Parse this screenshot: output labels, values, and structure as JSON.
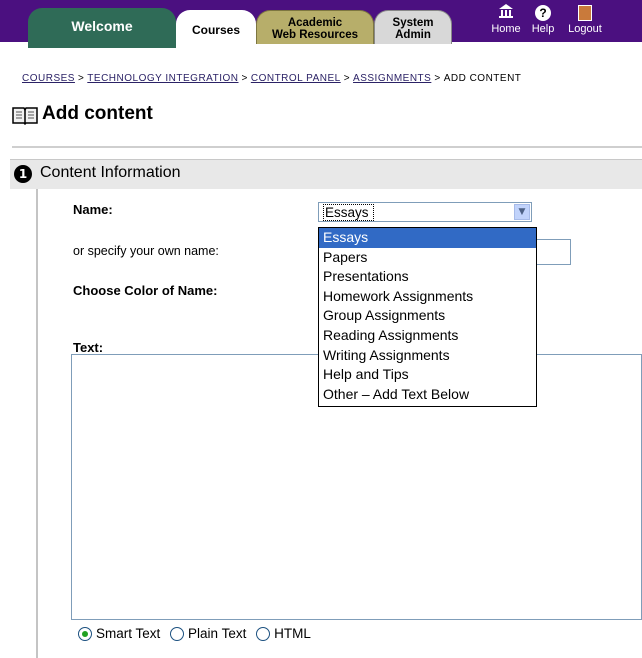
{
  "nav": {
    "tabs": [
      {
        "label": "Welcome"
      },
      {
        "label": "Courses"
      },
      {
        "label_line1": "Academic",
        "label_line2": "Web Resources"
      },
      {
        "label_line1": "System",
        "label_line2": "Admin"
      }
    ],
    "home_label": "Home",
    "help_label": "Help",
    "logout_label": "Logout"
  },
  "breadcrumb": {
    "items": [
      "COURSES",
      "TECHNOLOGY INTEGRATION",
      "CONTROL PANEL",
      "ASSIGNMENTS",
      "ADD CONTENT"
    ],
    "separator": ">"
  },
  "page": {
    "title": "Add content"
  },
  "section": {
    "number": "1",
    "title": "Content Information"
  },
  "form": {
    "name_label": "Name:",
    "own_name_label": "or specify your own name:",
    "color_label": "Choose Color of Name:",
    "text_label": "Text:",
    "name_select": {
      "selected": "Essays",
      "options": [
        "Essays",
        "Papers",
        "Presentations",
        "Homework Assignments",
        "Group Assignments",
        "Reading Assignments",
        "Writing Assignments",
        "Help and Tips",
        "Other – Add Text Below"
      ]
    },
    "format_options": [
      {
        "label": "Smart Text",
        "checked": true
      },
      {
        "label": "Plain Text",
        "checked": false
      },
      {
        "label": "HTML",
        "checked": false
      }
    ]
  },
  "colors": {
    "nav_bg": "#4b1080",
    "welcome_tab": "#2f6b57",
    "academic_tab": "#b7ae6a",
    "system_tab": "#d8d8d8",
    "dropdown_highlight": "#316ac5"
  }
}
